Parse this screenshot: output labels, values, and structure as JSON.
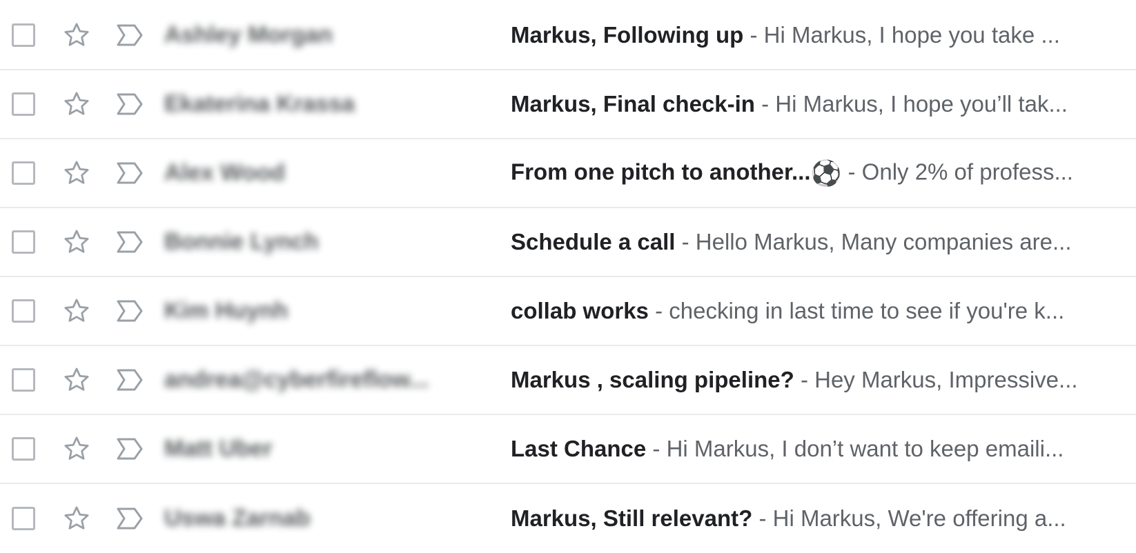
{
  "icons": {
    "checkbox": "checkbox-icon",
    "star": "star-outline-icon",
    "important": "important-marker-icon"
  },
  "separator": " - ",
  "emails": [
    {
      "sender": "Ashley Morgan",
      "subject": "Markus, Following up",
      "snippet": "Hi Markus, I hope you take ..."
    },
    {
      "sender": "Ekaterina Krassa",
      "subject": "Markus, Final check-in",
      "snippet": "Hi Markus, I hope you’ll tak..."
    },
    {
      "sender": "Alex Wood",
      "subject": "From one pitch to another...",
      "emoji": "⚽",
      "snippet": "Only 2% of profess..."
    },
    {
      "sender": "Bonnie Lynch",
      "subject": "Schedule a call",
      "snippet": "Hello Markus, Many companies are..."
    },
    {
      "sender": "Kim Huynh",
      "subject": "collab works",
      "snippet": "checking in last time to see if you're k..."
    },
    {
      "sender": "andrea@cyberfireflow...",
      "subject": "Markus , scaling pipeline?",
      "snippet": "Hey Markus, Impressive..."
    },
    {
      "sender": "Matt Uber",
      "subject": "Last Chance",
      "snippet": "Hi Markus, I don’t want to keep emaili..."
    },
    {
      "sender": "Uswa Zarnab",
      "subject": "Markus, Still relevant?",
      "snippet": "Hi Markus, We're offering a..."
    }
  ]
}
